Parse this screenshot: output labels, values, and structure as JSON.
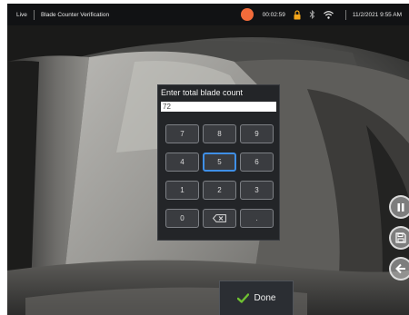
{
  "status_bar": {
    "mode": "Live",
    "title": "Blade Counter Verification",
    "timer": "00:02:59",
    "datetime": "11/2/2021  9:55 AM",
    "record_color": "#f26b3a",
    "lock_color": "#f2a51a",
    "icons": [
      "record-icon",
      "lock-icon",
      "bluetooth-icon",
      "wifi-icon"
    ]
  },
  "dialog": {
    "title": "Enter total blade count",
    "input_value": "72",
    "keys": [
      "7",
      "8",
      "9",
      "4",
      "5",
      "6",
      "1",
      "2",
      "3",
      "0",
      "backspace",
      "."
    ],
    "selected_key": "5",
    "selection_color": "#3f8fe6"
  },
  "done_button": {
    "label": "Done",
    "icon": "checkmark-icon",
    "icon_color": "#6fc132"
  },
  "side_controls": {
    "icons": [
      "pause-icon",
      "save-icon",
      "back-arrow-icon"
    ]
  }
}
